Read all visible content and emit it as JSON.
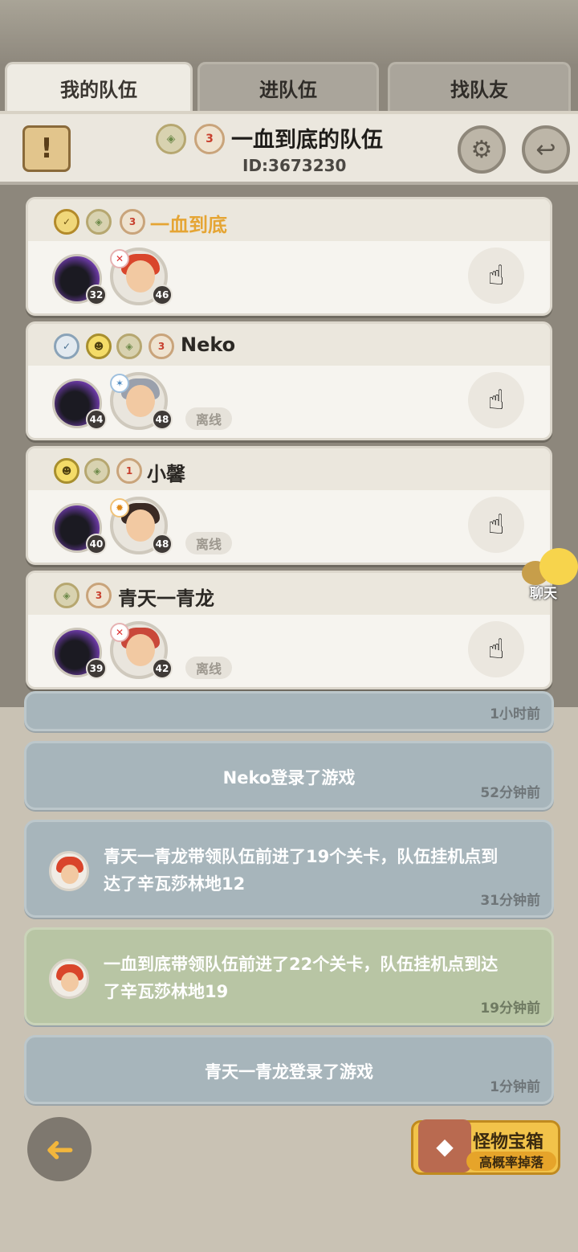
{
  "tabs": [
    {
      "label": "我的队伍",
      "active": true
    },
    {
      "label": "进队伍",
      "active": false
    },
    {
      "label": "找队友",
      "active": false
    }
  ],
  "team": {
    "name": "一血到底的队伍",
    "id": "ID:3673230",
    "badge_level": "3"
  },
  "members": [
    {
      "name": "一血到底",
      "pet_level": "32",
      "hero_level": "46",
      "status": "",
      "badge_level": "3",
      "hair": "#d9452b"
    },
    {
      "name": "Neko",
      "pet_level": "44",
      "hero_level": "48",
      "status": "离线",
      "badge_level": "3",
      "hair": "#9aa0ac"
    },
    {
      "name": "小馨",
      "pet_level": "40",
      "hero_level": "48",
      "status": "离线",
      "badge_level": "1",
      "hair": "#3a2a24"
    },
    {
      "name": "青天一青龙",
      "pet_level": "39",
      "hero_level": "42",
      "status": "离线",
      "badge_level": "3",
      "hair": "#c9483a"
    }
  ],
  "chat": {
    "label": "聊天"
  },
  "log": {
    "partial_time": "1小时前",
    "entries": [
      {
        "name": "Neko",
        "text": "登录了游戏",
        "time": "52分钟前"
      },
      {
        "name": "青天一青龙",
        "text_line1": "带领队伍前进了19个关卡，队伍挂机点到",
        "text_line2_prefix": "达了",
        "place": "辛瓦莎林地12",
        "time": "31分钟前"
      },
      {
        "name": "一血到底",
        "text_line1": "带领队伍前进了22个关卡，队伍挂机点到达",
        "text_line2_prefix": "了",
        "place": "辛瓦莎林地19",
        "time": "19分钟前"
      },
      {
        "name": "青天一青龙",
        "text": "登录了游戏",
        "time": "1分钟前"
      }
    ]
  },
  "bottom": {
    "chest_title": "怪物宝箱",
    "chest_subtitle": "高概率掉落"
  },
  "colors": {
    "highlight_name": "#e5a534",
    "log_blue": "#a7b5bb",
    "log_green": "#b8c5a4"
  }
}
